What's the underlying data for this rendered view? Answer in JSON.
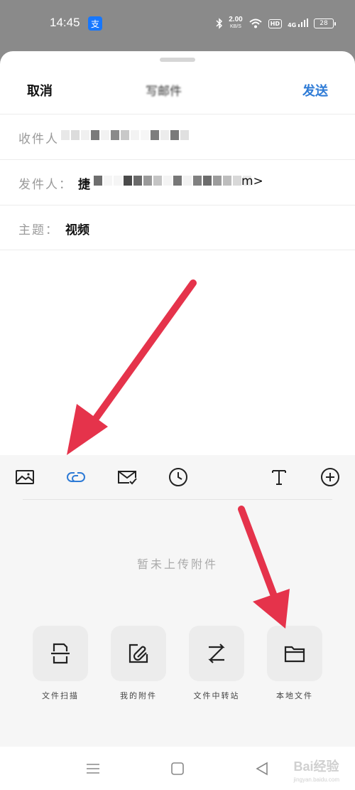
{
  "status_bar": {
    "time": "14:45",
    "app_badge": "支",
    "net_speed_value": "2.00",
    "net_speed_unit": "KB/S",
    "hd_label": "HD",
    "signal_label": "4G",
    "battery_level": "28"
  },
  "header": {
    "cancel_label": "取消",
    "title": "写邮件",
    "send_label": "发送"
  },
  "fields": {
    "to_label": "收件人",
    "from_label": "发件人：",
    "from_value_start": "捷",
    "from_value_end": "m>",
    "subject_label": "主题：",
    "subject_value": "视频"
  },
  "toolbar": {
    "items": [
      {
        "icon": "image-icon"
      },
      {
        "icon": "link-icon"
      },
      {
        "icon": "mail-check-icon"
      },
      {
        "icon": "clock-icon"
      },
      {
        "icon": "text-format-icon"
      },
      {
        "icon": "plus-circle-icon"
      }
    ]
  },
  "attachments": {
    "empty_message": "暂未上传附件",
    "options": [
      {
        "label": "文件扫描",
        "icon": "scan-file-icon"
      },
      {
        "label": "我的附件",
        "icon": "my-attachments-icon"
      },
      {
        "label": "文件中转站",
        "icon": "transfer-station-icon"
      },
      {
        "label": "本地文件",
        "icon": "folder-icon"
      }
    ]
  },
  "watermark": {
    "brand": "Bai经验",
    "url": "jingyan.baidu.com"
  },
  "colors": {
    "accent_blue": "#2e7bd6",
    "arrow_red": "#e5334b",
    "panel_bg": "#f6f6f6"
  }
}
